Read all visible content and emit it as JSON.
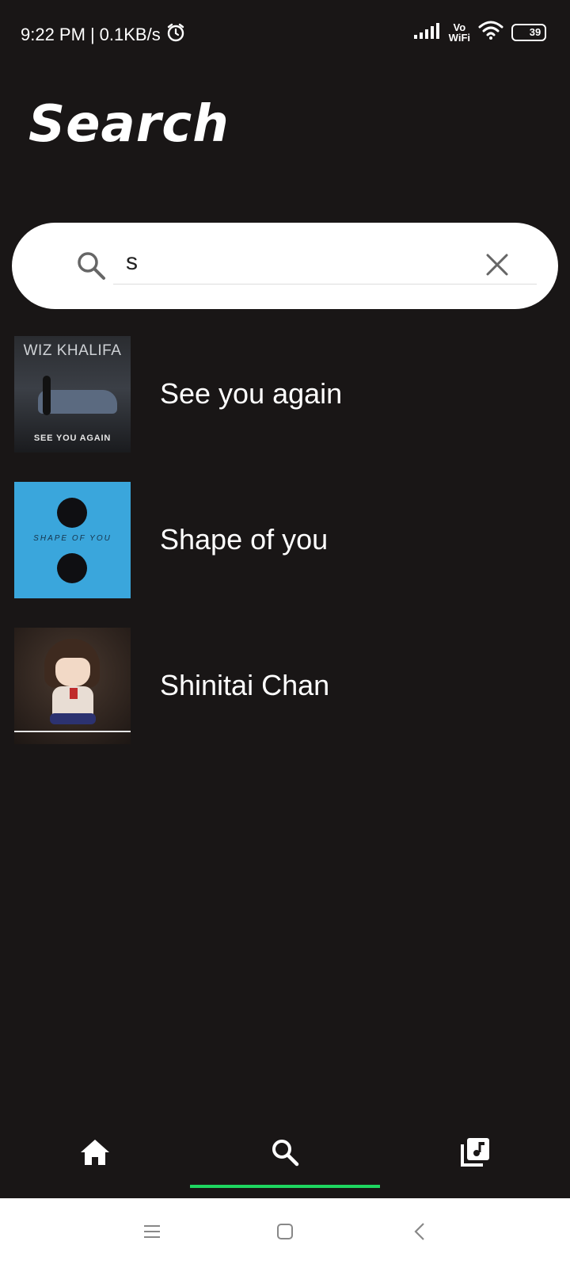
{
  "status_bar": {
    "time": "9:22 PM",
    "separator": "|",
    "speed": "0.1KB/s",
    "vowifi_top": "Vo",
    "vowifi_bottom": "WiFi",
    "battery": "39"
  },
  "page": {
    "title": "Search"
  },
  "search": {
    "value": "s",
    "placeholder": ""
  },
  "results": [
    {
      "title": "See you again",
      "art_artist": "WIZ KHALIFA",
      "art_subtitle": "SEE YOU AGAIN"
    },
    {
      "title": "Shape of you",
      "art_caption": "SHAPE OF YOU"
    },
    {
      "title": "Shinitai Chan"
    }
  ],
  "bottom_nav": {
    "items": [
      {
        "icon": "home-icon"
      },
      {
        "icon": "search-icon",
        "active": true
      },
      {
        "icon": "library-music-icon"
      }
    ],
    "accent_color": "#1ed760"
  },
  "colors": {
    "background": "#191616",
    "search_bar": "#ffffff"
  }
}
